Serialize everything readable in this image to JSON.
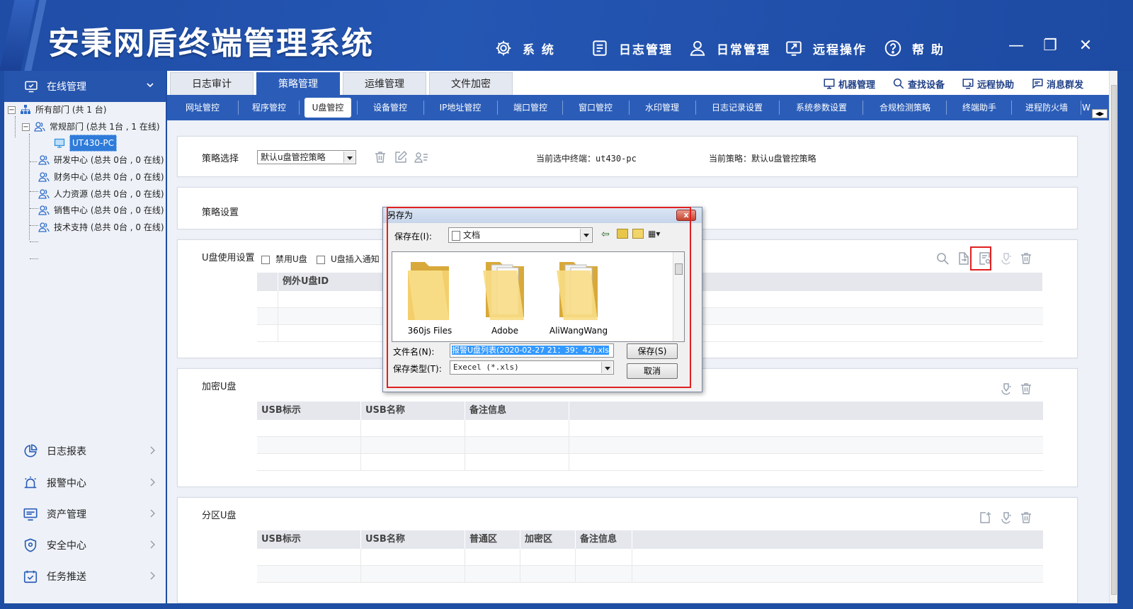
{
  "app": {
    "title": "安秉网盾终端管理系统",
    "menu": [
      {
        "label": "系 统",
        "icon": "gear-icon"
      },
      {
        "label": "日志管理",
        "icon": "document-icon"
      },
      {
        "label": "日常管理",
        "icon": "user-icon"
      },
      {
        "label": "远程操作",
        "icon": "remote-icon"
      },
      {
        "label": "帮 助",
        "icon": "help-icon"
      }
    ],
    "window_controls": {
      "minimize": "—",
      "restore": "❐",
      "close": "✕"
    }
  },
  "sidebar": {
    "online_label": "在线管理",
    "tree": {
      "root": "所有部门 (共 1 台)",
      "dept_regular": "常规部门 (总共 1台 , 1 在线)",
      "selected_pc": "UT430-PC",
      "depts": [
        "研发中心 (总共 0台 , 0 在线)",
        "财务中心 (总共 0台 , 0 在线)",
        "人力资源 (总共 0台 , 0 在线)",
        "销售中心 (总共 0台 , 0 在线)",
        "技术支持 (总共 0台 , 0 在线)"
      ]
    },
    "nav": [
      {
        "label": "日志报表",
        "icon": "pie-chart-icon"
      },
      {
        "label": "报警中心",
        "icon": "alarm-icon"
      },
      {
        "label": "资产管理",
        "icon": "monitor-icon"
      },
      {
        "label": "安全中心",
        "icon": "shield-icon"
      },
      {
        "label": "任务推送",
        "icon": "task-icon"
      }
    ]
  },
  "tabs": [
    "日志审计",
    "策略管理",
    "运维管理",
    "文件加密"
  ],
  "tools": [
    "机器管理",
    "查找设备",
    "远程协助",
    "消息群发"
  ],
  "subtabs": [
    "网址管控",
    "程序管控",
    "U盘管控",
    "设备管控",
    "IP地址管控",
    "端口管控",
    "窗口管控",
    "水印管理",
    "日志记录设置",
    "系统参数设置",
    "合规检测策略",
    "终端助手",
    "进程防火墙",
    "W"
  ],
  "policy": {
    "select_label": "策略选择",
    "select_value": "默认u盘管控策略",
    "current_terminal": "当前选中终端：ut430-pc",
    "current_policy": "当前策略：默认u盘管控策略",
    "settings_label": "策略设置"
  },
  "usb_usage": {
    "label": "U盘使用设置",
    "disable_label": "禁用U盘",
    "notify_label": "U盘插入通知",
    "col": "例外U盘ID"
  },
  "encrypted": {
    "label": "加密U盘",
    "cols": [
      "USB标示",
      "USB名称",
      "备注信息"
    ]
  },
  "partition": {
    "label": "分区U盘",
    "cols": [
      "USB标示",
      "USB名称",
      "普通区",
      "加密区",
      "备注信息"
    ]
  },
  "dialog": {
    "title": "另存为",
    "close": "x",
    "save_in_label": "保存在(I):",
    "save_in_value": "文档",
    "folders": [
      "360js Files",
      "Adobe",
      "AliWangWang"
    ],
    "filename_label": "文件名(N):",
    "filename_value": "报警U盘列表(2020-02-27 21：39：42).xls",
    "filetype_label": "保存类型(T):",
    "filetype_value": "Execel (*.xls)",
    "save_btn": "保存(S)",
    "cancel_btn": "取消"
  },
  "colors": {
    "primary": "#2b5db8",
    "header": "#1f4da6",
    "highlight": "#e02020"
  }
}
